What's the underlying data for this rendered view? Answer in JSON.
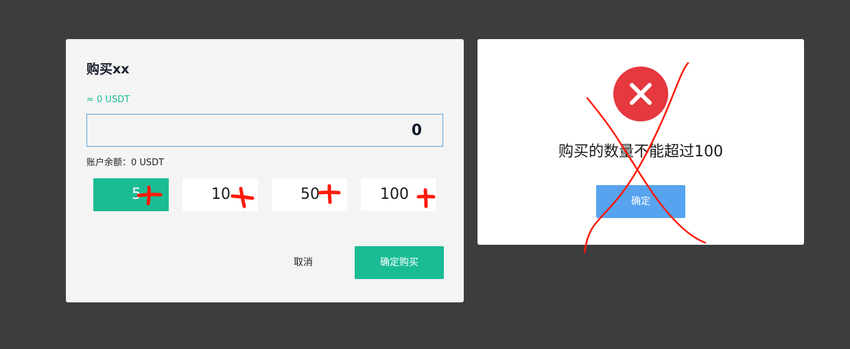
{
  "buy_dialog": {
    "title": "购买xx",
    "approx": "≈ 0 USDT",
    "amount_value": "0",
    "balance": "账户余额：0 USDT",
    "quick_amounts": [
      {
        "label": "5",
        "active": true
      },
      {
        "label": "10",
        "active": false
      },
      {
        "label": "50",
        "active": false
      },
      {
        "label": "100",
        "active": false
      }
    ],
    "cancel_label": "取消",
    "confirm_label": "确定购买"
  },
  "error_dialog": {
    "message": "购买的数量不能超过100",
    "ok_label": "确定"
  },
  "colors": {
    "backdrop": "#3c3d3f",
    "accent_green": "#1abc96",
    "error_red": "#e5383f",
    "ok_blue": "#57a3ef",
    "annotation_red": "#ff1a0a"
  },
  "annotations": {
    "plus_marks": "plus-annotation-icon",
    "cross_out": "cross-out-annotation"
  }
}
